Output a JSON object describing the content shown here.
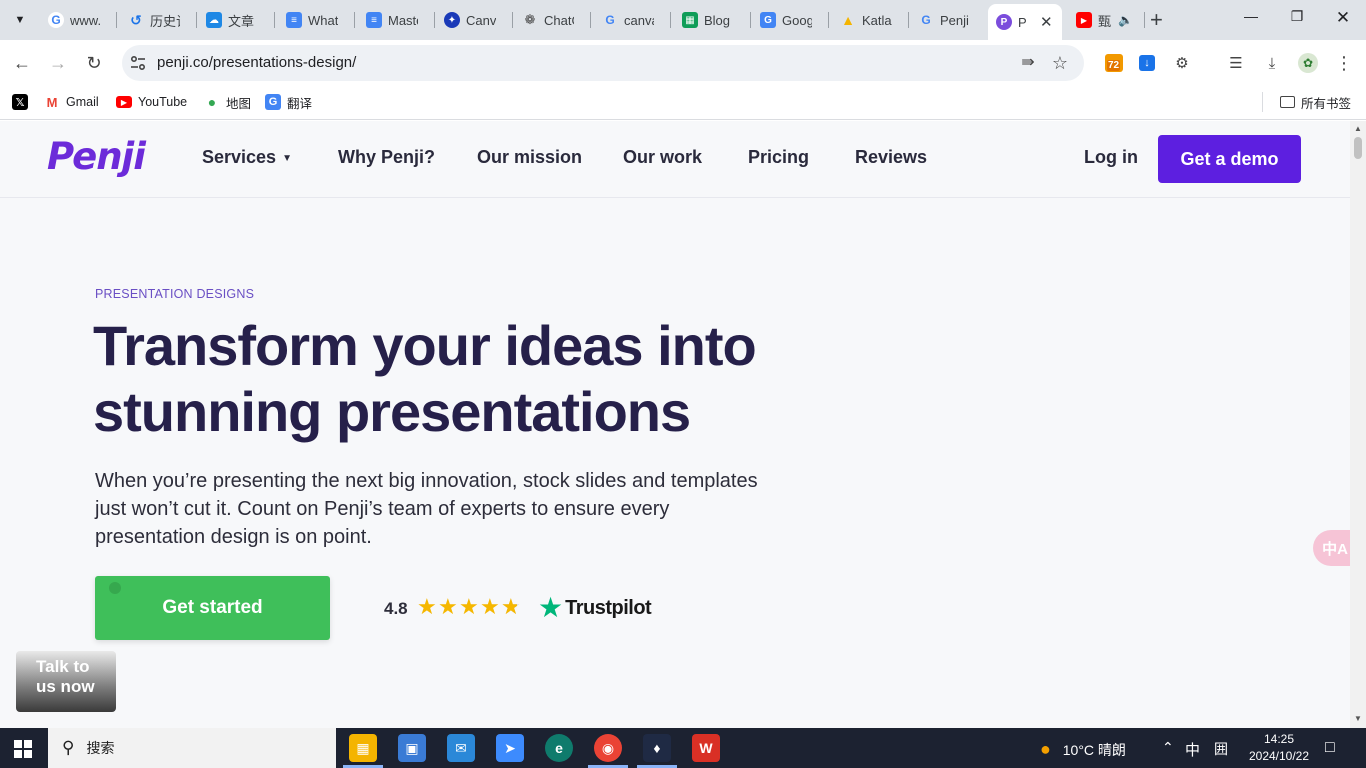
{
  "browser": {
    "tabs": [
      {
        "label": "www.",
        "icon": "google-icon",
        "color": "#4285f4"
      },
      {
        "label": "历史记",
        "icon": "history-icon",
        "color": "#1a73e8"
      },
      {
        "label": "文章",
        "icon": "cloud-icon",
        "color": "#1e88e5"
      },
      {
        "label": "What",
        "icon": "docs-icon",
        "color": "#4285f4"
      },
      {
        "label": "Maste",
        "icon": "docs-icon",
        "color": "#4285f4"
      },
      {
        "label": "Canva",
        "icon": "canva-icon",
        "color": "#1a3ab8"
      },
      {
        "label": "ChatG",
        "icon": "chatgpt-icon",
        "color": "#444444"
      },
      {
        "label": "canva",
        "icon": "google-icon",
        "color": "#4285f4"
      },
      {
        "label": "Blog",
        "icon": "sheets-icon",
        "color": "#0f9d58"
      },
      {
        "label": "Goog",
        "icon": "translate-icon",
        "color": "#4285f4"
      },
      {
        "label": "Katla",
        "icon": "katla-icon",
        "color": "#f4b400"
      },
      {
        "label": "Penji",
        "icon": "google-icon",
        "color": "#4285f4"
      },
      {
        "label": "P",
        "icon": "penji-icon",
        "color": "#7b4ddc",
        "active": true
      },
      {
        "label": "甄",
        "icon": "youtube-icon",
        "color": "#ff0000",
        "audio": true
      }
    ],
    "url": "penji.co/presentations-design/",
    "extension_badge": "72",
    "bookmarks": [
      {
        "label": "",
        "icon": "x-icon"
      },
      {
        "label": "Gmail",
        "icon": "gmail-icon"
      },
      {
        "label": "YouTube",
        "icon": "youtube-icon"
      },
      {
        "label": "地图",
        "icon": "maps-icon"
      },
      {
        "label": "翻译",
        "icon": "translate-icon"
      }
    ],
    "all_bookmarks_label": "所有书签"
  },
  "site": {
    "logo": "Penji",
    "nav": {
      "services": "Services",
      "why": "Why Penji?",
      "mission": "Our mission",
      "work": "Our work",
      "pricing": "Pricing",
      "reviews": "Reviews"
    },
    "login": "Log in",
    "demo": "Get a demo",
    "hero": {
      "eyebrow": "PRESENTATION DESIGNS",
      "headline_line1": "Transform your ideas into",
      "headline_line2": "stunning presentations",
      "lead": "When you’re presenting the next big innovation, stock slides and templates just won’t cut it. Count on Penji’s team of experts to ensure every presentation design is on point.",
      "cta": "Get started",
      "rating": "4.8",
      "stars": 4.8,
      "trustpilot": "Trustpilot"
    },
    "chat_line1": "Talk to",
    "chat_line2": "us now",
    "translate_fab": "中A"
  },
  "taskbar": {
    "search_placeholder": "搜索",
    "weather": "10°C 晴朗",
    "ime": "中",
    "ime_mode": "囲",
    "time": "14:25",
    "date": "2024/10/22"
  },
  "colors": {
    "brand_purple": "#5d1fe0",
    "cta_green": "#3fbf5a",
    "headline": "#26204a",
    "trustpilot_green": "#00b67a"
  }
}
